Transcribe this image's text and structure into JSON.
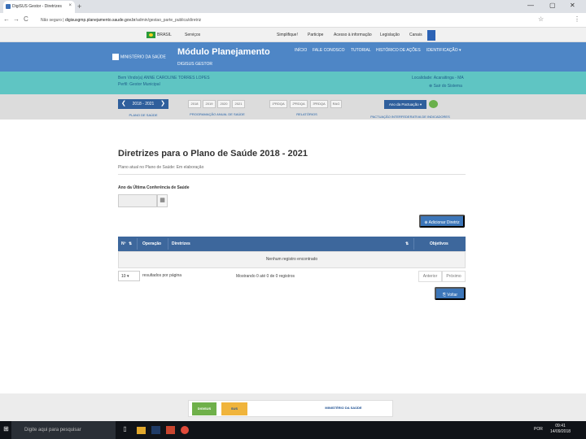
{
  "browser": {
    "tab_title": "DigiSUS Gestor - Diretrizes",
    "tab_close": "×",
    "new_tab": "+",
    "minimize": "—",
    "maximize": "▢",
    "close": "✕",
    "back": "←",
    "forward": "→",
    "reload": "C",
    "security_note": "Não seguro",
    "url_domain": "digisusgmp.planejamento.saude.gov.br",
    "url_path": "/admin/gestao_parte_publica/diretriz",
    "star": "☆",
    "menu": "⋮"
  },
  "gov_bar": {
    "brasil": "BRASIL",
    "servicos": "Serviços",
    "links": [
      "Simplifique!",
      "Participe",
      "Acesso à informação",
      "Legislação",
      "Canais"
    ]
  },
  "header": {
    "ministry": "MINISTÉRIO DA SAÚDE",
    "title": "Módulo Planejamento",
    "subtitle": "DIGISUS GESTOR",
    "nav": [
      "INÍCIO",
      "FALE CONOSCO",
      "TUTORIAL",
      "HISTÓRICO DE AÇÕES",
      "IDENTIFICAÇÃO ▾"
    ]
  },
  "user_bar": {
    "user": "Bem Vindo(a) ANNE CAROLINE TORRES LOPES",
    "profile": "Perfil: Gestor Municipal",
    "location": "Localidade: Acaraitinga - MA",
    "logout": "⊗ Sair do Sistema"
  },
  "toolbar": {
    "plan_label": "2018 - 2021",
    "prev": "❮",
    "next": "❯",
    "plan_caption": "PLANO DE SAÚDE",
    "years": [
      "2018",
      "2019",
      "2020",
      "2021"
    ],
    "years_caption": "PROGRAMAÇÃO ANUAL DE SAÚDE",
    "reports": [
      "1ºRDQA",
      "2ºRDQA",
      "3ºRDQA",
      "RAG"
    ],
    "reports_caption": "RELATÓRIOS",
    "pactuacao_label": "Ano da Pactuação ▾",
    "pactuacao_caption": "PACTUAÇÃO INTERFEDERATIVA DE INDICADORES"
  },
  "page": {
    "title": "Diretrizes para o Plano de Saúde 2018 - 2021",
    "description": "Plano atual no Plano de Saúde: Em elaboração",
    "field_label": "Ano da Última Conferência de Saúde",
    "calendar_icon": "▦",
    "add_button": "⊕ Adicionar Diretriz",
    "table_headers": [
      "Nº",
      "Operação",
      "Diretrizes",
      "Objetivos"
    ],
    "sort_icon": "⇅",
    "empty_row": "Nenhum registro encontrado",
    "per_page_value": "10",
    "per_page_label": "resultados por página",
    "info": "Mostrando 0 até 0 de 0 registros",
    "prev_label": "Anterior",
    "next_label": "Próximo",
    "back_button": "⎘ Voltar"
  },
  "footer": {
    "logos": [
      "DIGISUS",
      "SUS",
      "MINISTÉRIO DA SAÚDE"
    ]
  },
  "taskbar": {
    "start": "⊞",
    "search_placeholder": "Digite aqui para pesquisar",
    "clock_time": "09:41",
    "clock_date": "14/09/2018",
    "lang": "POR"
  }
}
